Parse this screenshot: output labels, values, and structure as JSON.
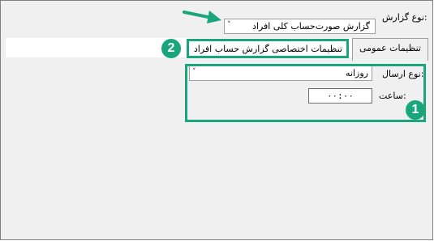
{
  "report": {
    "type_label": "نوع گزارش:",
    "type_value": "گزارش صورت‌حساب کلی افراد",
    "arrow_glyph": "˅"
  },
  "tabs": {
    "general_label": "تنظیمات عمومی",
    "personal_label": "تنظیمات اختصاصی گزارش حساب افراد"
  },
  "general": {
    "send_type_label": "نوع ارسال:",
    "send_type_value": "روزانه",
    "time_label": "ساعت:",
    "time_value": "۰۰:۰۰"
  },
  "annotations": {
    "badge_1": "1",
    "badge_2": "2",
    "color": "#1aa67c"
  }
}
